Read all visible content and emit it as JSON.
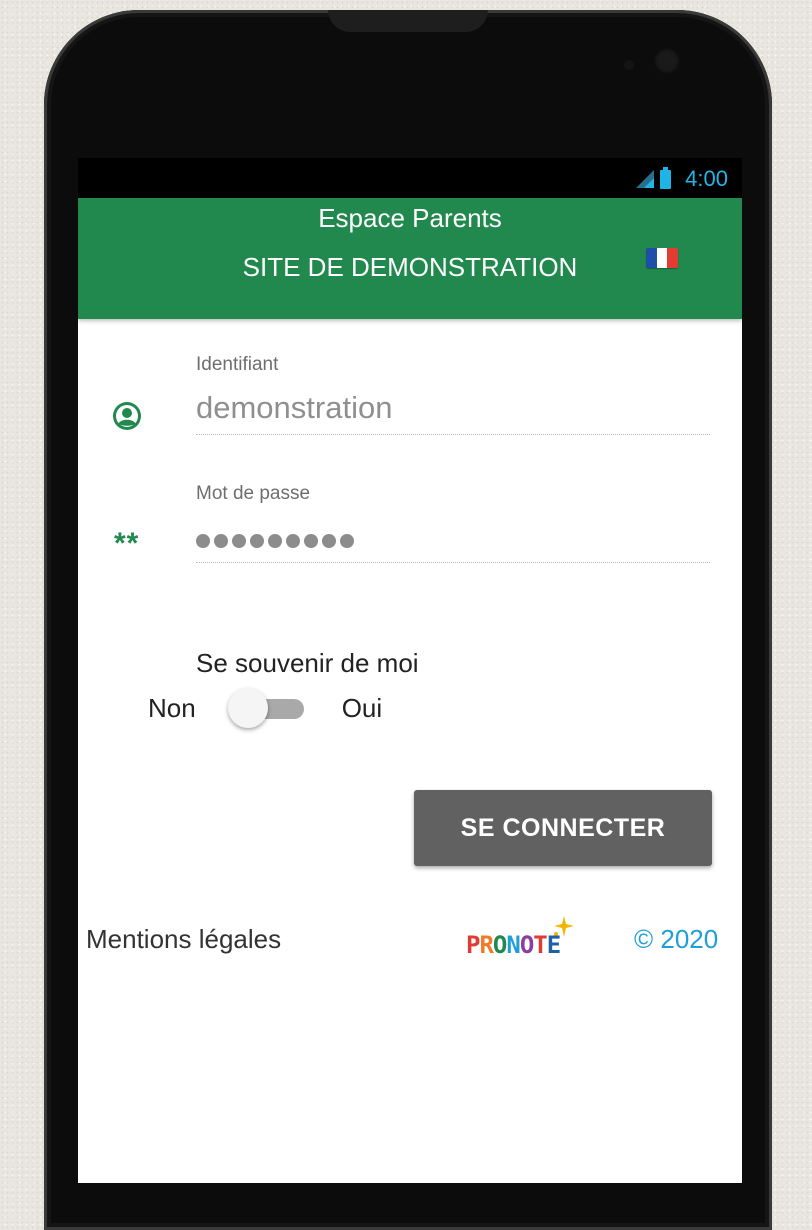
{
  "status_bar": {
    "time": "4:00"
  },
  "header": {
    "title": "Espace Parents",
    "subtitle": "SITE DE DEMONSTRATION",
    "flag_colors": [
      "#1f4ea6",
      "#ffffff",
      "#e23b32"
    ]
  },
  "form": {
    "identifiant": {
      "label": "Identifiant",
      "value": "demonstration",
      "icon": "user-circle-icon"
    },
    "password": {
      "label": "Mot de passe",
      "masked_length": 9,
      "icon_text": "**"
    }
  },
  "remember": {
    "label": "Se souvenir de moi",
    "off_label": "Non",
    "on_label": "Oui",
    "state": "Non"
  },
  "connect_button": {
    "label": "SE CONNECTER"
  },
  "footer": {
    "legal_link": "Mentions légales",
    "logo_text": "PRONOTE",
    "logo_colors": [
      "#e23b32",
      "#f07a2a",
      "#22894e",
      "#1e9fd8",
      "#8a3fa0",
      "#e23b32",
      "#1e5fa8"
    ],
    "copyright": "© 2020"
  },
  "colors": {
    "header_green": "#22894e",
    "button_gray": "#616161",
    "link_blue": "#1e9fd8",
    "status_blue": "#22b4e8"
  }
}
